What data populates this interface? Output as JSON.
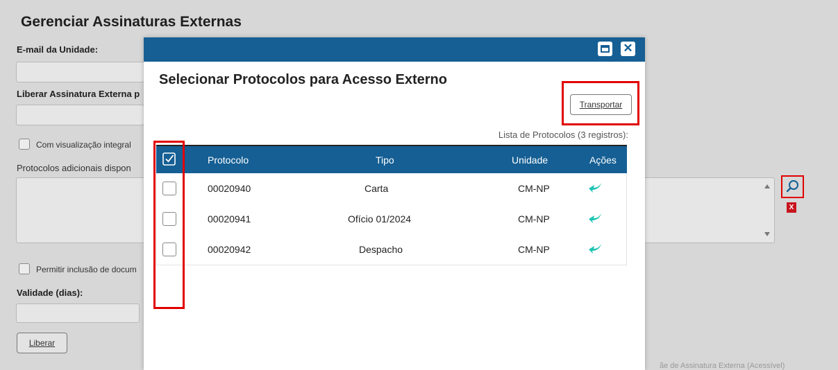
{
  "page": {
    "title": "Gerenciar Assinaturas Externas",
    "email_label": "E-mail da Unidade:",
    "liberar_label": "Liberar Assinatura Externa p",
    "visualizacao_label": "Com visualização integral",
    "protocolos_label": "Protocolos adicionais dispon",
    "permitir_label": "Permitir inclusão de docum",
    "validade_label": "Validade (dias):",
    "liberar_button": "Liberar",
    "remove_glyph": "X",
    "bottom_faint_text": "ãe de Assinatura Externa (Acessível)"
  },
  "modal": {
    "title": "Selecionar Protocolos para Acesso Externo",
    "transport_button": "Transportar",
    "list_caption": "Lista de Protocolos (3 registros):",
    "close_glyph": "✕",
    "columns": {
      "protocolo": "Protocolo",
      "tipo": "Tipo",
      "unidade": "Unidade",
      "acoes": "Ações"
    },
    "rows": [
      {
        "protocolo": "00020940",
        "tipo": "Carta",
        "unidade": "CM-NP"
      },
      {
        "protocolo": "00020941",
        "tipo": "Ofício 01/2024",
        "unidade": "CM-NP"
      },
      {
        "protocolo": "00020942",
        "tipo": "Despacho",
        "unidade": "CM-NP"
      }
    ]
  },
  "icons": {
    "select_all": "checkbox-checked-icon",
    "row_action": "transport-arrow-icon",
    "search": "magnifier-icon",
    "maximize": "maximize-icon",
    "close": "close-icon"
  },
  "colors": {
    "header_blue": "#155f94",
    "highlight_red": "#e10000",
    "action_teal": "#1fc4b4",
    "remove_red": "#c8141e"
  }
}
